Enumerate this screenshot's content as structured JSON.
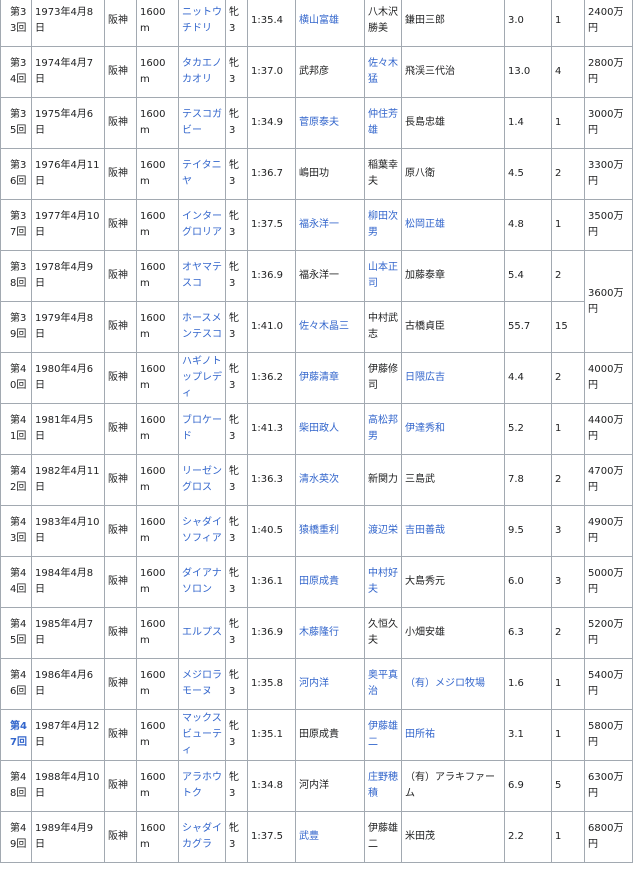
{
  "rows": [
    {
      "race": "第33回",
      "date": "1973年4月8日",
      "venue": "阪神",
      "distance": "1600m",
      "horse": "ニットウチドリ",
      "horse_link": true,
      "sex": "牝3",
      "time": "1:35.4",
      "jockey": "横山富雄",
      "jockey_link": true,
      "trainer": "八木沢勝美",
      "trainer_link": false,
      "owner": "鎌田三郎",
      "owner_link": false,
      "odds": "3.0",
      "pop": "1",
      "prize": "2400万円"
    },
    {
      "race": "第34回",
      "date": "1974年4月7日",
      "venue": "阪神",
      "distance": "1600m",
      "horse": "タカエノカオリ",
      "horse_link": true,
      "sex": "牝3",
      "time": "1:37.0",
      "jockey": "武邦彦",
      "jockey_link": false,
      "trainer": "佐々木猛",
      "trainer_link": true,
      "owner": "飛渓三代治",
      "owner_link": false,
      "odds": "13.0",
      "pop": "4",
      "prize": "2800万円"
    },
    {
      "race": "第35回",
      "date": "1975年4月6日",
      "venue": "阪神",
      "distance": "1600m",
      "horse": "テスコガビー",
      "horse_link": true,
      "sex": "牝3",
      "time": "1:34.9",
      "jockey": "菅原泰夫",
      "jockey_link": true,
      "trainer": "仲住芳雄",
      "trainer_link": true,
      "owner": "長島忠雄",
      "owner_link": false,
      "odds": "1.4",
      "pop": "1",
      "prize": "3000万円"
    },
    {
      "race": "第36回",
      "date": "1976年4月11日",
      "venue": "阪神",
      "distance": "1600m",
      "horse": "テイタニヤ",
      "horse_link": true,
      "sex": "牝3",
      "time": "1:36.7",
      "jockey": "嶋田功",
      "jockey_link": false,
      "trainer": "稲葉幸夫",
      "trainer_link": false,
      "owner": "原八衛",
      "owner_link": false,
      "odds": "4.5",
      "pop": "2",
      "prize": "3300万円"
    },
    {
      "race": "第37回",
      "date": "1977年4月10日",
      "venue": "阪神",
      "distance": "1600m",
      "horse": "インターグロリア",
      "horse_link": true,
      "sex": "牝3",
      "time": "1:37.5",
      "jockey": "福永洋一",
      "jockey_link": true,
      "trainer": "柳田次男",
      "trainer_link": true,
      "owner": "松岡正雄",
      "owner_link": true,
      "odds": "4.8",
      "pop": "1",
      "prize": "3500万円"
    },
    {
      "race": "第38回",
      "date": "1978年4月9日",
      "venue": "阪神",
      "distance": "1600m",
      "horse": "オヤマテスコ",
      "horse_link": true,
      "sex": "牝3",
      "time": "1:36.9",
      "jockey": "福永洋一",
      "jockey_link": false,
      "trainer": "山本正司",
      "trainer_link": true,
      "owner": "加藤泰章",
      "owner_link": false,
      "odds": "5.4",
      "pop": "2",
      "prize": "3600万円"
    },
    {
      "race": "第39回",
      "date": "1979年4月8日",
      "venue": "阪神",
      "distance": "1600m",
      "horse": "ホースメンテスコ",
      "horse_link": true,
      "sex": "牝3",
      "time": "1:41.0",
      "jockey": "佐々木晶三",
      "jockey_link": true,
      "trainer": "中村武志",
      "trainer_link": false,
      "owner": "古橋貞臣",
      "owner_link": false,
      "odds": "55.7",
      "pop": "15",
      "prize": ""
    },
    {
      "race": "第40回",
      "date": "1980年4月6日",
      "venue": "阪神",
      "distance": "1600m",
      "horse": "ハギノトップレディ",
      "horse_link": true,
      "sex": "牝3",
      "time": "1:36.2",
      "jockey": "伊藤清章",
      "jockey_link": true,
      "trainer": "伊藤修司",
      "trainer_link": false,
      "owner": "日隈広吉",
      "owner_link": true,
      "odds": "4.4",
      "pop": "2",
      "prize": "4000万円"
    },
    {
      "race": "第41回",
      "date": "1981年4月5日",
      "venue": "阪神",
      "distance": "1600m",
      "horse": "ブロケード",
      "horse_link": true,
      "sex": "牝3",
      "time": "1:41.3",
      "jockey": "柴田政人",
      "jockey_link": true,
      "trainer": "高松邦男",
      "trainer_link": true,
      "owner": "伊達秀和",
      "owner_link": true,
      "odds": "5.2",
      "pop": "1",
      "prize": "4400万円"
    },
    {
      "race": "第42回",
      "date": "1982年4月11日",
      "venue": "阪神",
      "distance": "1600m",
      "horse": "リーゼングロス",
      "horse_link": true,
      "sex": "牝3",
      "time": "1:36.3",
      "jockey": "清水英次",
      "jockey_link": true,
      "trainer": "新関力",
      "trainer_link": false,
      "owner": "三島武",
      "owner_link": false,
      "odds": "7.8",
      "pop": "2",
      "prize": "4700万円"
    },
    {
      "race": "第43回",
      "date": "1983年4月10日",
      "venue": "阪神",
      "distance": "1600m",
      "horse": "シャダイソフィア",
      "horse_link": true,
      "sex": "牝3",
      "time": "1:40.5",
      "jockey": "猿橋重利",
      "jockey_link": true,
      "trainer": "渡辺栄",
      "trainer_link": true,
      "owner": "吉田善哉",
      "owner_link": true,
      "odds": "9.5",
      "pop": "3",
      "prize": "4900万円"
    },
    {
      "race": "第44回",
      "date": "1984年4月8日",
      "venue": "阪神",
      "distance": "1600m",
      "horse": "ダイアナソロン",
      "horse_link": true,
      "sex": "牝3",
      "time": "1:36.1",
      "jockey": "田原成貴",
      "jockey_link": true,
      "trainer": "中村好夫",
      "trainer_link": true,
      "owner": "大島秀元",
      "owner_link": false,
      "odds": "6.0",
      "pop": "3",
      "prize": "5000万円"
    },
    {
      "race": "第45回",
      "date": "1985年4月7日",
      "venue": "阪神",
      "distance": "1600m",
      "horse": "エルプス",
      "horse_link": true,
      "sex": "牝3",
      "time": "1:36.9",
      "jockey": "木藤隆行",
      "jockey_link": true,
      "trainer": "久恒久夫",
      "trainer_link": false,
      "owner": "小畑安雄",
      "owner_link": false,
      "odds": "6.3",
      "pop": "2",
      "prize": "5200万円"
    },
    {
      "race": "第46回",
      "date": "1986年4月6日",
      "venue": "阪神",
      "distance": "1600m",
      "horse": "メジロラモーヌ",
      "horse_link": true,
      "sex": "牝3",
      "time": "1:35.8",
      "jockey": "河内洋",
      "jockey_link": true,
      "trainer": "奥平真治",
      "trainer_link": true,
      "owner": "（有）メジロ牧場",
      "owner_link": true,
      "odds": "1.6",
      "pop": "1",
      "prize": "5400万円"
    },
    {
      "race": "第47回",
      "date": "1987年4月12日",
      "venue": "阪神",
      "distance": "1600m",
      "horse": "マックスビューティ",
      "horse_link": true,
      "sex": "牝3",
      "time": "1:35.1",
      "jockey": "田原成貴",
      "jockey_link": false,
      "trainer": "伊藤雄二",
      "trainer_link": true,
      "owner": "田所祐",
      "owner_link": true,
      "odds": "3.1",
      "pop": "1",
      "prize": "5800万円"
    },
    {
      "race": "第48回",
      "date": "1988年4月10日",
      "venue": "阪神",
      "distance": "1600m",
      "horse": "アラホウトク",
      "horse_link": true,
      "sex": "牝3",
      "time": "1:34.8",
      "jockey": "河内洋",
      "jockey_link": false,
      "trainer": "庄野穂積",
      "trainer_link": true,
      "owner": "（有）アラキファーム",
      "owner_link": false,
      "odds": "6.9",
      "pop": "5",
      "prize": "6300万円"
    },
    {
      "race": "第49回",
      "date": "1989年4月9日",
      "venue": "阪神",
      "distance": "1600m",
      "horse": "シャダイカグラ",
      "horse_link": true,
      "sex": "牝3",
      "time": "1:37.5",
      "jockey": "武豊",
      "jockey_link": true,
      "trainer": "伊藤雄二",
      "trainer_link": false,
      "owner": "米田茂",
      "owner_link": false,
      "odds": "2.2",
      "pop": "1",
      "prize": "6800万円"
    }
  ]
}
